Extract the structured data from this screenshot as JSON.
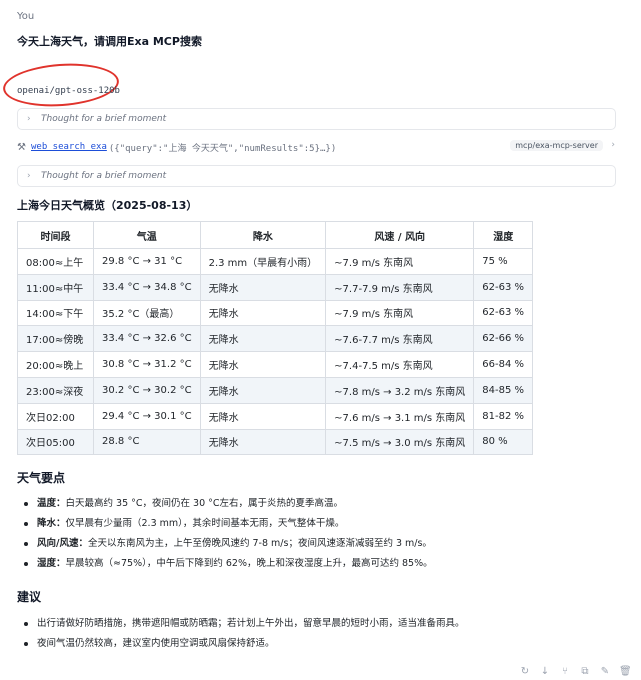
{
  "conversation": {
    "user_label": "You",
    "user_message": "今天上海天气，请调用Exa MCP搜索",
    "model_name": "openai/gpt-oss-120b",
    "thought_1": "Thought for a brief moment",
    "thought_2": "Thought for a brief moment",
    "tool_call": {
      "name": "web_search_exa",
      "args": "({\"query\":\"上海 今天天气\",\"numResults\":5}…})",
      "badge": "mcp/exa-mcp-server"
    }
  },
  "overview": {
    "title": "上海今日天气概览（2025-08-13）",
    "headers": [
      "时间段",
      "气温",
      "降水",
      "风速 / 风向",
      "湿度"
    ],
    "rows": [
      [
        "08:00≈上午",
        "29.8 °C → 31 °C",
        "2.3 mm（早晨有小雨）",
        "~7.9 m/s 东南风",
        "75 %"
      ],
      [
        "11:00≈中午",
        "33.4 °C → 34.8 °C",
        "无降水",
        "~7.7-7.9 m/s 东南风",
        "62-63 %"
      ],
      [
        "14:00≈下午",
        "35.2 °C（最高）",
        "无降水",
        "~7.9 m/s 东南风",
        "62-63 %"
      ],
      [
        "17:00≈傍晚",
        "33.4 °C → 32.6 °C",
        "无降水",
        "~7.6-7.7 m/s 东南风",
        "62-66 %"
      ],
      [
        "20:00≈晚上",
        "30.8 °C → 31.2 °C",
        "无降水",
        "~7.4-7.5 m/s 东南风",
        "66-84 %"
      ],
      [
        "23:00≈深夜",
        "30.2 °C → 30.2 °C",
        "无降水",
        "~7.8 m/s → 3.2 m/s 东南风",
        "84-85 %"
      ],
      [
        "次日02:00",
        "29.4 °C → 30.1 °C",
        "无降水",
        "~7.6 m/s → 3.1 m/s 东南风",
        "81-82 %"
      ],
      [
        "次日05:00",
        "28.8 °C",
        "无降水",
        "~7.5 m/s → 3.0 m/s 东南风",
        "80 %"
      ]
    ]
  },
  "points": {
    "title": "天气要点",
    "items": [
      {
        "label": "温度：",
        "text": "白天最高约 35 °C，夜间仍在 30 °C左右，属于炎热的夏季高温。"
      },
      {
        "label": "降水：",
        "text": "仅早晨有少量雨（2.3 mm），其余时间基本无雨，天气整体干燥。"
      },
      {
        "label": "风向/风速：",
        "text": "全天以东南风为主，上午至傍晚风速约 7-8 m/s；夜间风速逐渐减弱至约 3 m/s。"
      },
      {
        "label": "湿度：",
        "text": "早晨较高（≈75%），中午后下降到约 62%，晚上和深夜湿度上升，最高可达约 85%。"
      }
    ]
  },
  "advice": {
    "title": "建议",
    "items": [
      "出行请做好防晒措施，携带遮阳帽或防晒霜；若计划上午外出，留意早晨的短时小雨，适当准备雨具。",
      "夜间气温仍然较高，建议室内使用空调或风扇保持舒适。"
    ]
  },
  "icons": {
    "chevron": "chevron-right-icon",
    "tool": "hammer-icon",
    "actions": [
      "regenerate-icon",
      "arrow-down-icon",
      "branch-icon",
      "copy-icon",
      "edit-icon",
      "delete-icon"
    ]
  },
  "colors": {
    "highlight_circle": "#e0332c",
    "link": "#1d4ed8",
    "row_alt": "#f1f5f9"
  }
}
